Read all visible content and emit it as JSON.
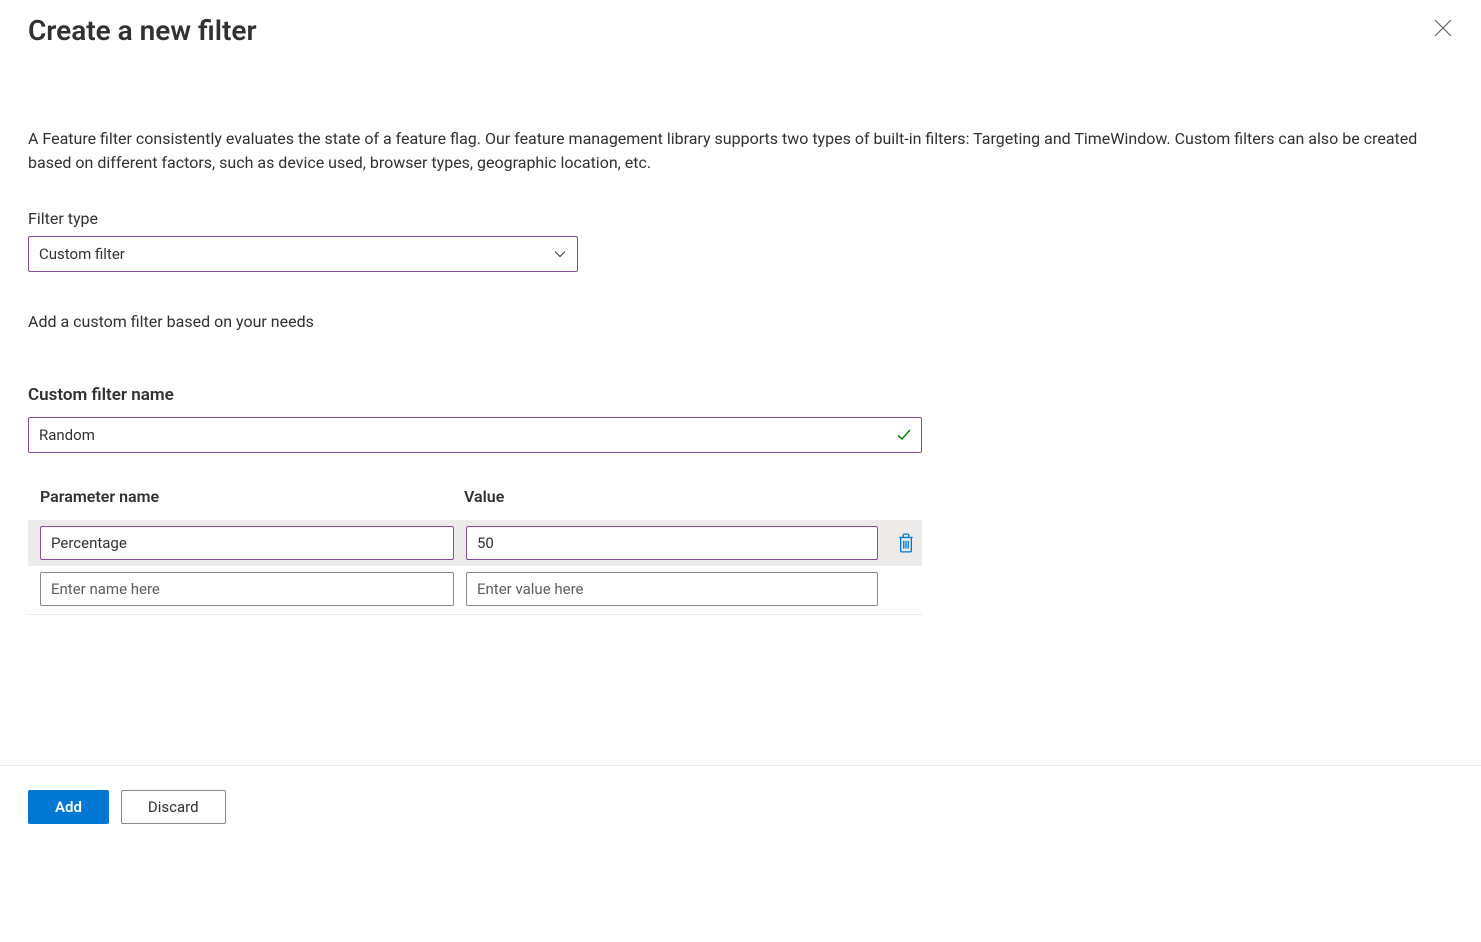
{
  "header": {
    "title": "Create a new filter"
  },
  "description": "A Feature filter consistently evaluates the state of a feature flag. Our feature management library supports two types of built-in filters: Targeting and TimeWindow. Custom filters can also be created based on different factors, such as device used, browser types, geographic location, etc.",
  "filterType": {
    "label": "Filter type",
    "selected": "Custom filter",
    "helper": "Add a custom filter based on your needs"
  },
  "customName": {
    "label": "Custom filter name",
    "value": "Random"
  },
  "params": {
    "col_name": "Parameter name",
    "col_value": "Value",
    "rows": [
      {
        "name": "Percentage",
        "value": "50"
      }
    ],
    "placeholder_name": "Enter name here",
    "placeholder_value": "Enter value here"
  },
  "footer": {
    "add": "Add",
    "discard": "Discard"
  }
}
